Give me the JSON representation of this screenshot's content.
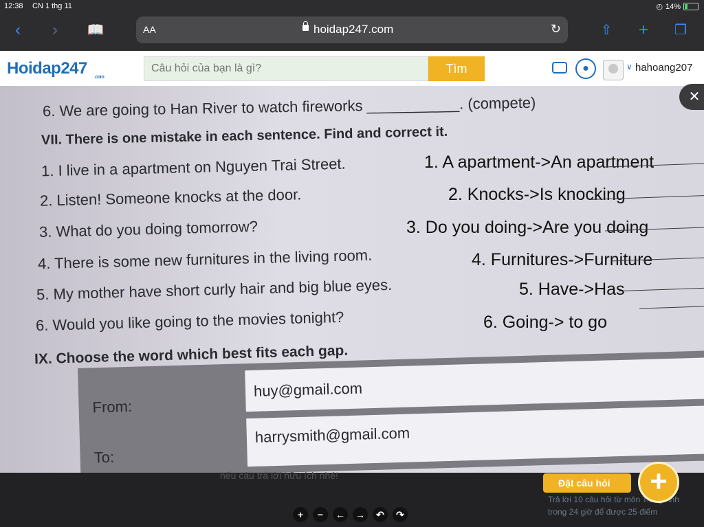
{
  "status_bar": {
    "time": "12:38",
    "date": "CN 1 thg 11",
    "battery": "14%"
  },
  "browser": {
    "aa_label": "AA",
    "url": "hoidap247.com"
  },
  "site": {
    "logo_text": "Hoidap247",
    "logo_sub": ".com",
    "search_placeholder": "Câu hỏi của bạn là gì?",
    "search_button": "Tìm",
    "username": "hahoang207"
  },
  "photo": {
    "top_line": "6.  We are going to Han River to watch fireworks ___________. (compete)",
    "section7_title": "VII. There is one mistake in each sentence. Find and correct it.",
    "sentences": [
      "1.  I live in a apartment on Nguyen Trai Street.",
      "2.  Listen! Someone knocks at the door.",
      "3.  What do you doing tomorrow?",
      "4.  There is some new furnitures in the living room.",
      "5.  My mother have short curly hair and big blue eyes.",
      "6.  Would you like going to the movies tonight?"
    ],
    "answers": [
      "1. A apartment->An apartment",
      "2. Knocks->Is knocking",
      "3. Do you doing->Are you doing",
      "4. Furnitures->Furniture",
      "5. Have->Has",
      "6. Going-> to go"
    ],
    "section9_title": "IX.  Choose the word which best fits each gap.",
    "from_label": "From:",
    "from_value": "huy@gmail.com",
    "to_label": "To:",
    "to_value": "harrysmith@gmail.com"
  },
  "bottom": {
    "ghost_text": "nếu câu trả lời hữu ích nhé!",
    "ask_label": "Đặt câu hỏi",
    "promo_text": "Trả lời 10 câu hỏi  từ môn Tiếng Anh  trong 24 giờ để được 25 điểm"
  }
}
